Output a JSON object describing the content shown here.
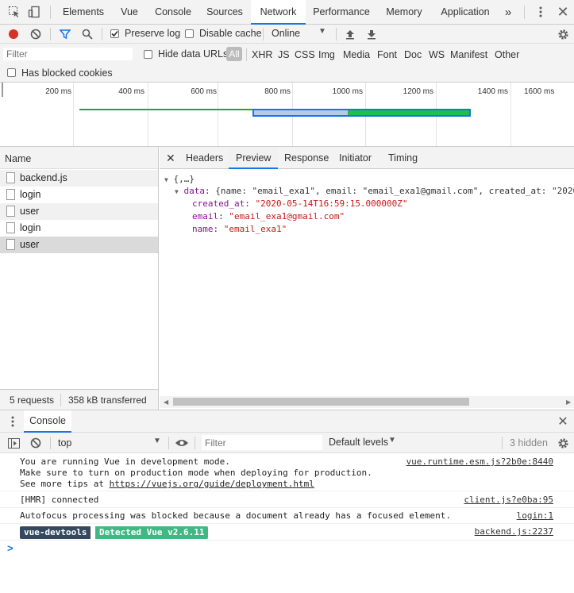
{
  "tabs": [
    "Elements",
    "Vue",
    "Console",
    "Sources",
    "Network",
    "Performance",
    "Memory",
    "Application"
  ],
  "active_tab": "Network",
  "toolbar": {
    "preserve_log": "Preserve log",
    "disable_cache": "Disable cache",
    "throttle": "Online"
  },
  "filter": {
    "placeholder": "Filter",
    "hide_data_urls": "Hide data URLs",
    "types": [
      "All",
      "XHR",
      "JS",
      "CSS",
      "Img",
      "Media",
      "Font",
      "Doc",
      "WS",
      "Manifest",
      "Other"
    ],
    "has_blocked_cookies": "Has blocked cookies"
  },
  "timeline": {
    "ticks": [
      "200 ms",
      "400 ms",
      "600 ms",
      "800 ms",
      "1000 ms",
      "1200 ms",
      "1400 ms",
      "1600 ms"
    ]
  },
  "requests": {
    "header": "Name",
    "items": [
      "backend.js",
      "login",
      "user",
      "login",
      "user"
    ],
    "count": "5 requests",
    "transferred": "358 kB transferred"
  },
  "detail": {
    "tabs": [
      "Headers",
      "Preview",
      "Response",
      "Initiator",
      "Timing"
    ],
    "active": "Preview",
    "root": "{,…}",
    "data_key": "data",
    "data_summary": "{name: \"email_exa1\", email: \"email_exa1@gmail.com\", created_at: \"2020",
    "fields": [
      {
        "key": "created_at",
        "value": "\"2020-05-14T16:59:15.000000Z\""
      },
      {
        "key": "email",
        "value": "\"email_exa1@gmail.com\""
      },
      {
        "key": "name",
        "value": "\"email_exa1\""
      }
    ]
  },
  "console": {
    "tab": "Console",
    "context": "top",
    "filter_placeholder": "Filter",
    "levels": "Default levels",
    "hidden": "3 hidden",
    "messages": [
      {
        "text": "You are running Vue in development mode.\nMake sure to turn on production mode when deploying for production.\nSee more tips at ",
        "link": "https://vuejs.org/guide/deployment.html",
        "source": "vue.runtime.esm.js?2b0e:8440"
      },
      {
        "text": "[HMR] connected",
        "source": "client.js?e0ba:95"
      },
      {
        "text": "Autofocus processing was blocked because a document already has a focused element.",
        "source": "login:1"
      },
      {
        "badge1": "vue-devtools",
        "badge2": "Detected Vue v2.6.11",
        "source": "backend.js:2237"
      }
    ],
    "prompt": ">"
  },
  "colors": {
    "record": "#d93025",
    "accent": "#1a73e8",
    "devtools_badge": "#35495e",
    "vue_badge": "#41b883",
    "key_purple": "#881391",
    "string_red": "#c41a16"
  }
}
